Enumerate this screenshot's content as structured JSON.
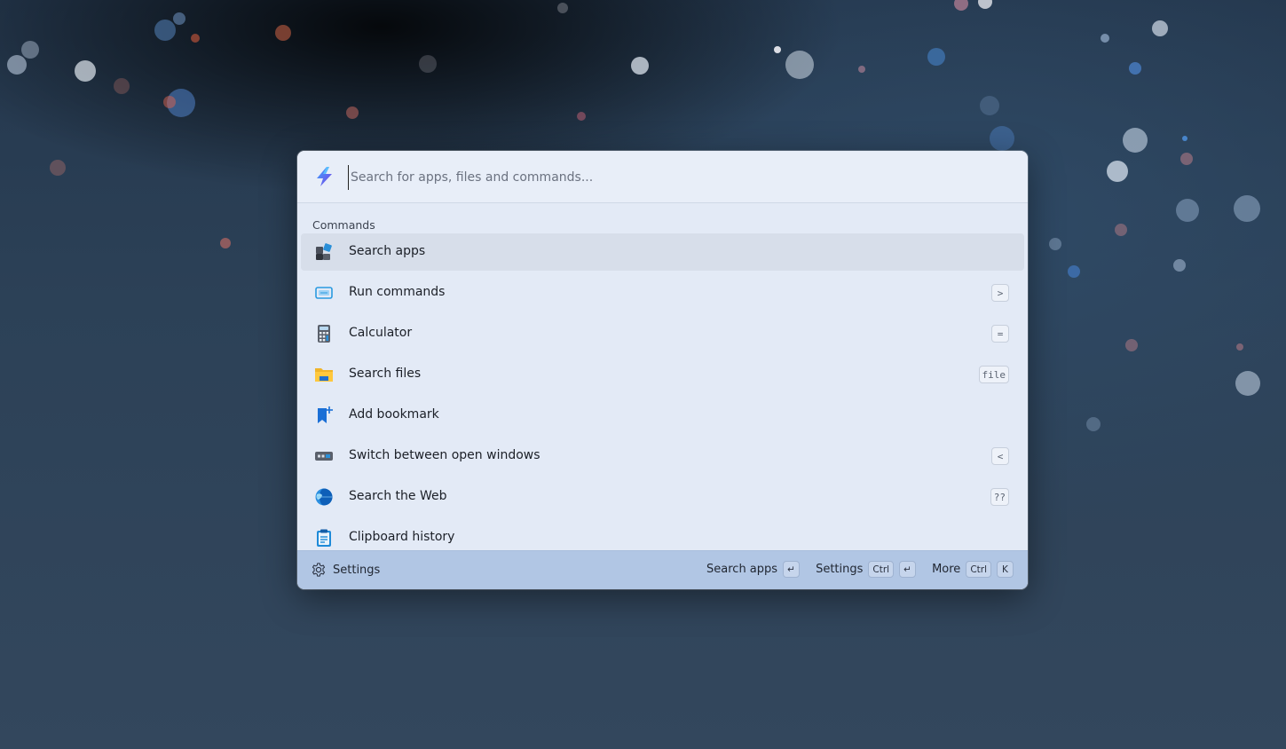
{
  "search": {
    "placeholder": "Search for apps, files and commands..."
  },
  "section": {
    "title": "Commands"
  },
  "items": [
    {
      "label": "Search apps",
      "shortcut": "",
      "icon": "apps-icon",
      "selected": true
    },
    {
      "label": "Run commands",
      "shortcut": ">",
      "icon": "terminal-icon",
      "selected": false
    },
    {
      "label": "Calculator",
      "shortcut": "=",
      "icon": "calculator-icon",
      "selected": false
    },
    {
      "label": "Search files",
      "shortcut": "file",
      "icon": "folder-icon",
      "selected": false
    },
    {
      "label": "Add bookmark",
      "shortcut": "",
      "icon": "bookmark-add-icon",
      "selected": false
    },
    {
      "label": "Switch between open windows",
      "shortcut": "<",
      "icon": "window-switcher-icon",
      "selected": false
    },
    {
      "label": "Search the Web",
      "shortcut": "??",
      "icon": "globe-icon",
      "selected": false
    },
    {
      "label": "Clipboard history",
      "shortcut": "",
      "icon": "clipboard-icon",
      "selected": false
    }
  ],
  "footer": {
    "settings_label": "Settings",
    "actions": [
      {
        "label": "Search apps",
        "keys": [
          "↵"
        ]
      },
      {
        "label": "Settings",
        "keys": [
          "Ctrl",
          "↵"
        ]
      },
      {
        "label": "More",
        "keys": [
          "Ctrl",
          "K"
        ]
      }
    ]
  },
  "colors": {
    "panel": "#e3eaf6",
    "footer": "#b1c6e4",
    "selected_row": "#d7deea"
  }
}
